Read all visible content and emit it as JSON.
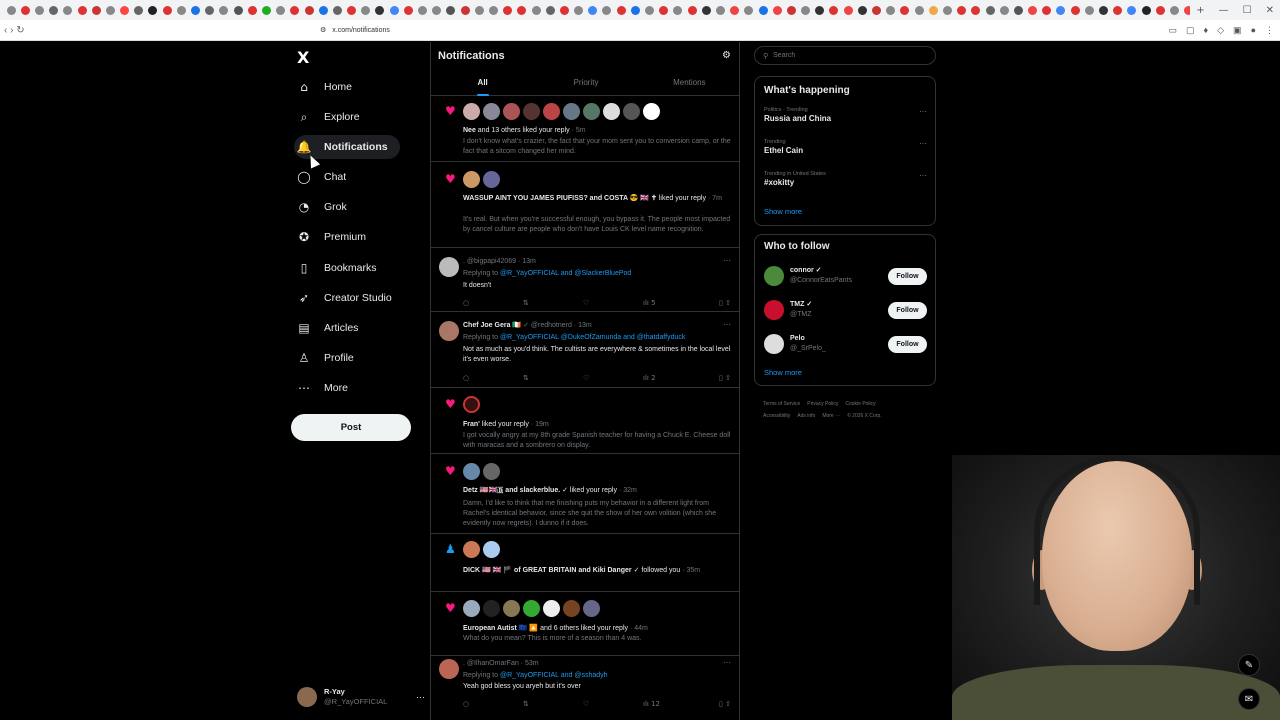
{
  "browser": {
    "url": "x.com/notifications",
    "tab_colors": [
      "#888",
      "#d33",
      "#888",
      "#666",
      "#888",
      "#d33",
      "#c33",
      "#888",
      "#f44",
      "#666",
      "#222",
      "#d33",
      "#888",
      "#1a73e8",
      "#666",
      "#888",
      "#555",
      "#d33",
      "#2a2",
      "#888",
      "#d33",
      "#c33",
      "#1a73e8",
      "#666",
      "#d33",
      "#888",
      "#333",
      "#4285f4",
      "#d33",
      "#888",
      "#888",
      "#555",
      "#c33",
      "#888",
      "#888",
      "#d33",
      "#d33",
      "#888",
      "#666",
      "#d33",
      "#888",
      "#4285f4",
      "#888",
      "#d33",
      "#1a73e8",
      "#888",
      "#d33",
      "#888",
      "#d33",
      "#333",
      "#888",
      "#e44",
      "#888",
      "#1a73e8",
      "#e44",
      "#c33",
      "#888",
      "#333",
      "#d33",
      "#e44",
      "#333",
      "#c33",
      "#888",
      "#d33",
      "#888",
      "#ea4",
      "#888",
      "#d33",
      "#d33",
      "#666",
      "#888",
      "#555",
      "#e44",
      "#d33",
      "#4285f4",
      "#d33",
      "#888",
      "#333",
      "#d33",
      "#4285f4",
      "#222",
      "#d33",
      "#888",
      "#e44",
      "#888",
      "#888",
      "#d33",
      "#333",
      "#222"
    ]
  },
  "nav": {
    "logo": "X",
    "items": [
      {
        "label": "Home",
        "icon": "home-icon",
        "glyph": "⌂"
      },
      {
        "label": "Explore",
        "icon": "search-icon",
        "glyph": "⌕"
      },
      {
        "label": "Notifications",
        "icon": "bell-icon",
        "glyph": "🔔"
      },
      {
        "label": "Chat",
        "icon": "chat-icon",
        "glyph": "◯"
      },
      {
        "label": "Grok",
        "icon": "grok-icon",
        "glyph": "◔"
      },
      {
        "label": "Premium",
        "icon": "premium-icon",
        "glyph": "✪"
      },
      {
        "label": "Bookmarks",
        "icon": "bookmark-icon",
        "glyph": "▯"
      },
      {
        "label": "Creator Studio",
        "icon": "rocket-icon",
        "glyph": "➶"
      },
      {
        "label": "Articles",
        "icon": "article-icon",
        "glyph": "▤"
      },
      {
        "label": "Profile",
        "icon": "person-icon",
        "glyph": "♙"
      },
      {
        "label": "More",
        "icon": "more-icon",
        "glyph": "⋯"
      }
    ],
    "post_label": "Post",
    "account": {
      "name": "R-Yay",
      "handle": "@R_YayOFFICIAL"
    }
  },
  "notifications": {
    "title": "Notifications",
    "tabs": [
      "All",
      "Priority",
      "Mentions"
    ],
    "n1": {
      "names": "Nee",
      "action": " and 13 others liked your reply",
      "time": " · 5m",
      "body": "I don't know what's crazier, the fact that your mom sent you to conversion camp, or the fact that a sitcom changed her mind."
    },
    "n2": {
      "names": "WASSUP AINT YOU JAMES PIUFISS? and COSTA 😎 🇬🇧 ✝",
      "action": " liked your reply",
      "time": " · 7m",
      "body": "It's real. But when you're successful enough, you bypass it. The people most impacted by cancel culture are people who don't have Louis CK level name recognition."
    },
    "r1": {
      "head": ". @bigpapi42069 · 13m",
      "reply_label": "Replying to ",
      "reply_to": "@R_YayOFFICIAL and @SlackerBluePod",
      "text": "It doesn't",
      "views": "5"
    },
    "r2": {
      "name": "Chef Joe Gera",
      "rest": " 🇮🇪 ✓ @redhotnerd · 13m",
      "reply_label": "Replying to ",
      "reply_to": "@R_YayOFFICIAL @DukeOfZamunda and @thatdaffyduck",
      "text": "Not as much as you'd think. The cultists are everywhere & sometimes in the local level it's even worse.",
      "views": "2"
    },
    "n3": {
      "names": "Fran'",
      "action": " liked your reply",
      "time": " · 19m",
      "body": "I got vocally angry at my 8th grade Spanish teacher for having a Chuck E. Cheese doll with maracas and a sombrero on display."
    },
    "n4": {
      "names": "Detz 🇺🇸🇬🇧🇧 and slackerblue.",
      "action": " ✓ liked your reply",
      "time": " · 32m",
      "body": "Damn, I'd like to think that me finishing puts my behavior in a different light from Rachel's identical behavior, since she quit the show of her own volition (which she evidently now regrets). I dunno if it does."
    },
    "n5": {
      "names": "DICK 🇺🇸 🇬🇧 🏴 of GREAT BRITAIN and Kiki Danger",
      "action": " ✓ followed you",
      "time": " · 35m"
    },
    "n6": {
      "names": "European Autist 🇪🇺 🔼",
      "action": " and 6 others liked your reply",
      "time": " · 44m",
      "body": "What do you mean? This is more of a season than 4 was."
    },
    "r3": {
      "head": ". @IlhanOmarFan · 53m",
      "reply_label": "Replying to ",
      "reply_to": "@R_YayOFFICIAL and @sshadyh",
      "text": "Yeah god bless you aryeh but it's over",
      "views": "12"
    }
  },
  "right": {
    "search_placeholder": "Search",
    "happening_title": "What's happening",
    "trends": [
      {
        "cat": "Politics · Trending",
        "name": "Russia and China"
      },
      {
        "cat": "Trending",
        "name": "Ethel Cain"
      },
      {
        "cat": "Trending in United States",
        "name": "#xokitty"
      }
    ],
    "show_more": "Show more",
    "who_title": "Who to follow",
    "who": [
      {
        "name": "connor ✓",
        "handle": "@ConnorEatsPants",
        "btn": "Follow",
        "color": "#4a8a3a"
      },
      {
        "name": "TMZ ✓",
        "handle": "@TMZ",
        "btn": "Follow",
        "color": "#c8102e"
      },
      {
        "name": "Pelo",
        "handle": "@_SrPelo_",
        "btn": "Follow",
        "color": "#ddd"
      }
    ],
    "show_more2": "Show more",
    "footer": [
      "Terms of Service",
      "Privacy Policy",
      "Cookie Policy",
      "Accessibility",
      "Ads info",
      "More ···",
      "© 2026 X Corp."
    ]
  }
}
